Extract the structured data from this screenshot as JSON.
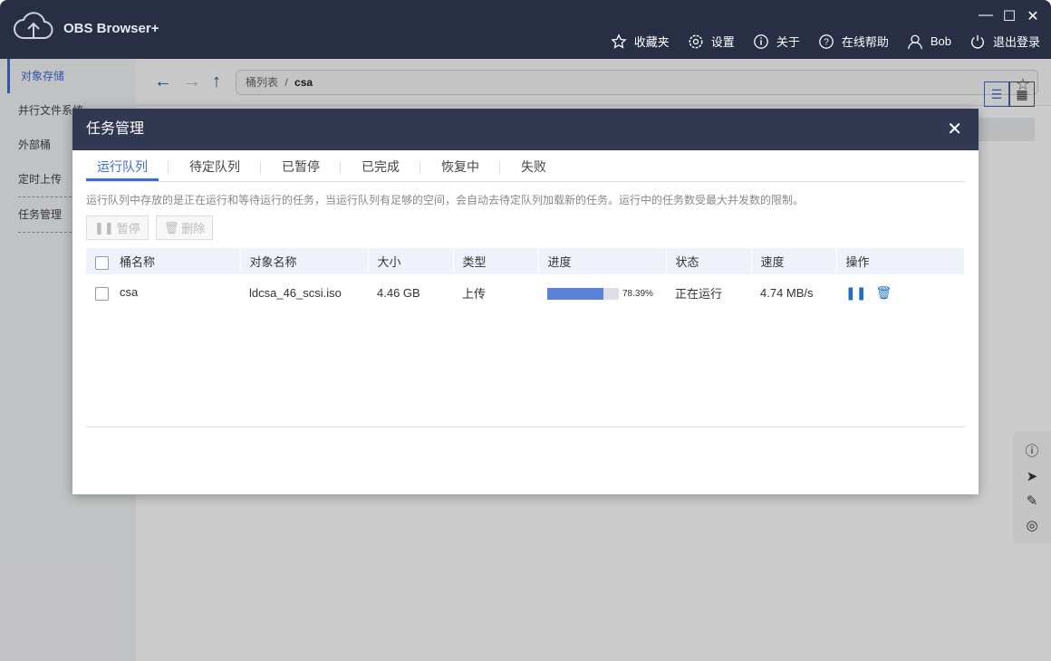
{
  "app": {
    "title": "OBS Browser+",
    "window": {
      "minimize": "—",
      "maximize": "☐",
      "close": "✕"
    }
  },
  "topnav": [
    {
      "icon": "star-icon",
      "label": "收藏夹"
    },
    {
      "icon": "gear-icon",
      "label": "设置"
    },
    {
      "icon": "info-icon",
      "label": "关于"
    },
    {
      "icon": "help-icon",
      "label": "在线帮助"
    },
    {
      "icon": "user-icon",
      "label": "Bob"
    },
    {
      "icon": "power-icon",
      "label": "退出登录"
    }
  ],
  "sidebar": [
    {
      "label": "对象存储"
    },
    {
      "label": "并行文件系统"
    },
    {
      "label": "外部桶"
    },
    {
      "label": "定时上传"
    },
    {
      "label": "任务管理"
    }
  ],
  "breadcrumb": {
    "root": "桶列表",
    "sep": "/",
    "current": "csa"
  },
  "modal": {
    "title": "任务管理",
    "close": "✕",
    "tabs": [
      "运行队列",
      "待定队列",
      "已暂停",
      "已完成",
      "恢复中",
      "失败"
    ],
    "description": "运行队列中存放的是正在运行和等待运行的任务，当运行队列有足够的空间，会自动去待定队列加载新的任务。运行中的任务数受最大并发数的限制。",
    "actions": {
      "pause": "暂停",
      "delete": "删除"
    },
    "columns": [
      "桶名称",
      "对象名称",
      "大小",
      "类型",
      "进度",
      "状态",
      "速度",
      "操作"
    ],
    "rows": [
      {
        "bucket": "csa",
        "object": "ldcsa_46_scsi.iso",
        "size": "4.46 GB",
        "type": "上传",
        "progress": 78.39,
        "progress_text": "78.39%",
        "status": "正在运行",
        "speed": "4.74 MB/s"
      }
    ]
  },
  "colors": {
    "titlebar": "#282e44",
    "accent": "#3e6bd1",
    "progress": "#5a82d8"
  }
}
